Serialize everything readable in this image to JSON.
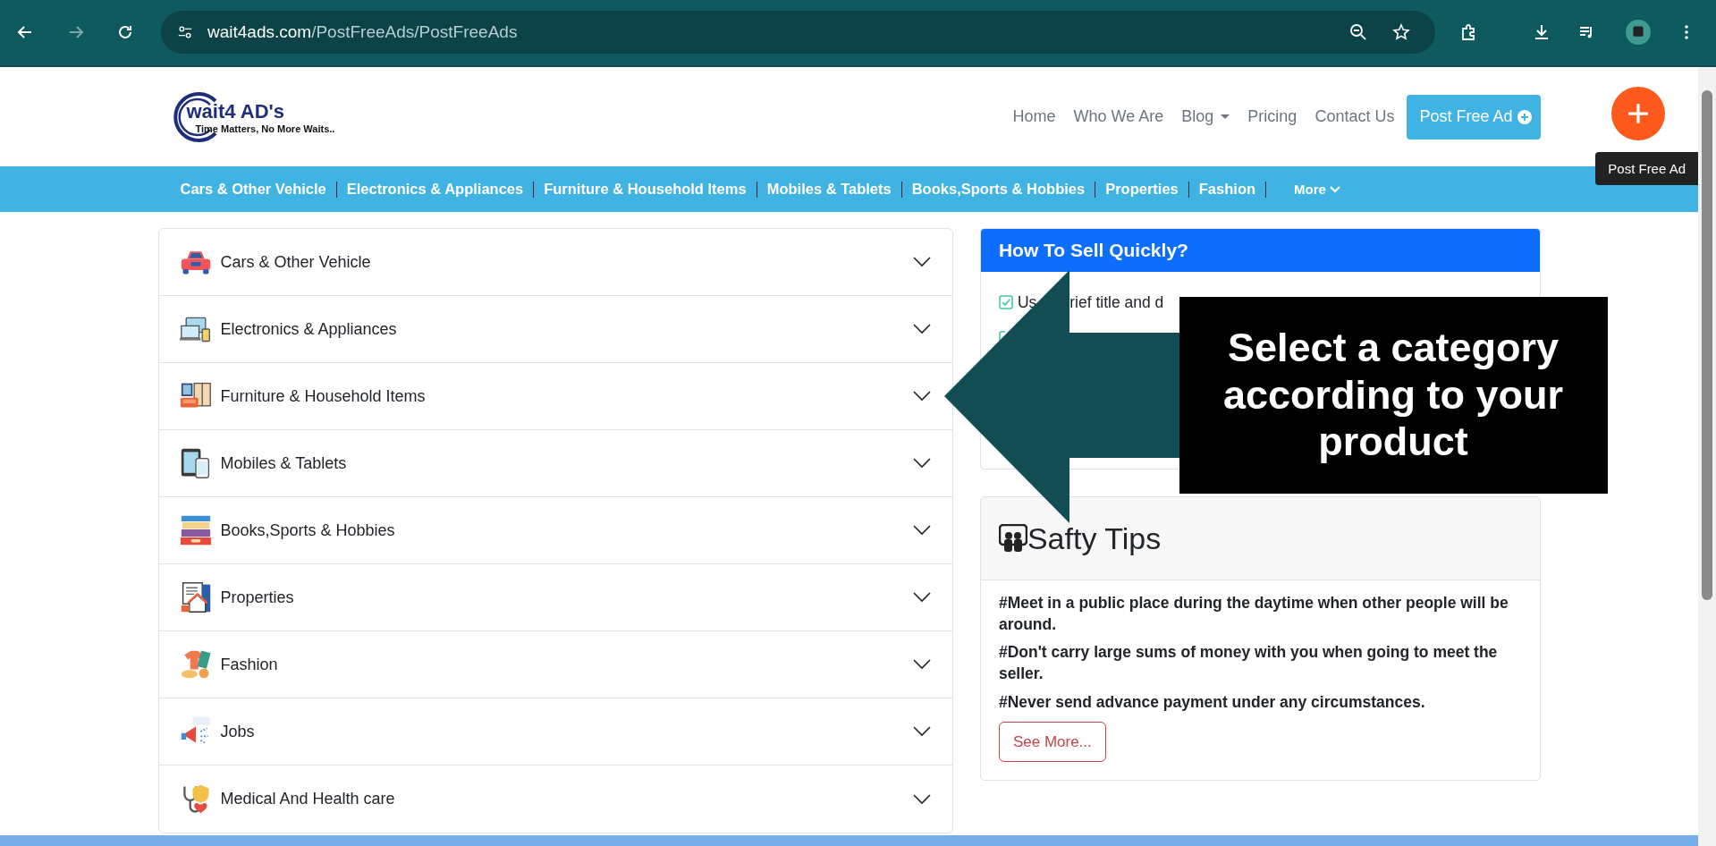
{
  "browser": {
    "url_host": "wait4ads.com",
    "url_path": "/PostFreeAds/PostFreeAds"
  },
  "logo": {
    "name": "wait4 AD's",
    "tagline": "Time Matters, No More Waits.."
  },
  "nav": [
    {
      "label": "Home",
      "dropdown": false
    },
    {
      "label": "Who We Are",
      "dropdown": false
    },
    {
      "label": "Blog",
      "dropdown": true
    },
    {
      "label": "Pricing",
      "dropdown": false
    },
    {
      "label": "Contact Us",
      "dropdown": false
    }
  ],
  "post_button": "Post Free Ad",
  "category_bar": {
    "items": [
      "Cars & Other Vehicle",
      "Electronics & Appliances",
      "Furniture & Household Items",
      "Mobiles & Tablets",
      "Books,Sports & Hobbies",
      "Properties",
      "Fashion"
    ],
    "more": "More"
  },
  "categories": [
    {
      "label": "Cars & Other Vehicle",
      "kind": "car",
      "expanded": false
    },
    {
      "label": "Electronics & Appliances",
      "kind": "devices",
      "expanded": false
    },
    {
      "label": "Furniture & Household Items",
      "kind": "furniture",
      "expanded": false
    },
    {
      "label": "Mobiles & Tablets",
      "kind": "tablet",
      "expanded": false
    },
    {
      "label": "Books,Sports & Hobbies",
      "kind": "books",
      "expanded": false
    },
    {
      "label": "Properties",
      "kind": "house",
      "expanded": false
    },
    {
      "label": "Fashion",
      "kind": "clothes",
      "expanded": false
    },
    {
      "label": "Jobs",
      "kind": "megaphone",
      "expanded": false
    },
    {
      "label": "Medical And Health care",
      "kind": "stethoscope",
      "expanded": false
    }
  ],
  "sell_card": {
    "title": "How To Sell Quickly?",
    "tips": [
      {
        "parts": [
          "Us",
          "rief title and d"
        ],
        "checked": true
      },
      {
        "kind": "covered"
      }
    ]
  },
  "safety_card": {
    "title": "Safty Tips",
    "tips": [
      "#Meet in a public place during the daytime when other people will be around.",
      "#Don't carry large sums of money with you when going to meet the seller.",
      "#Never send advance payment under any circumstances."
    ],
    "button": "See More..."
  },
  "fab": {
    "tooltip": "Post Free Ad"
  },
  "callout": {
    "text": "Select a category according to your product"
  }
}
